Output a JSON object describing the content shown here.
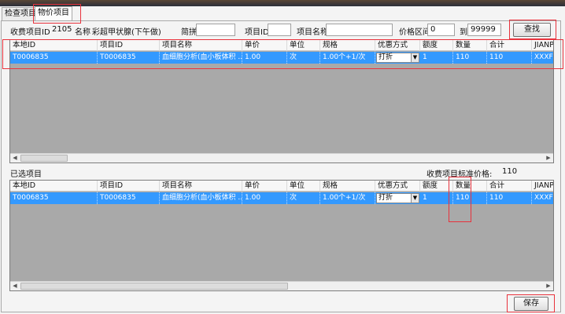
{
  "tabs": [
    "检查项目",
    "物价项目"
  ],
  "filters": {
    "charge_item_id_label": "收费项目ID",
    "charge_item_id_value": "2105",
    "name_label": "名称",
    "name_value": "彩超甲状腺(下午做)",
    "pinyin_label": "简拼",
    "pinyin_value": "",
    "item_id_label": "项目ID",
    "item_id_value": "",
    "item_name_label": "项目名称",
    "item_name_value": "",
    "price_range_label": "价格区间",
    "price_min": "0",
    "price_to_label": "到",
    "price_max": "99999",
    "search_button": "查找"
  },
  "columns": [
    "本地ID",
    "项目ID",
    "项目名称",
    "单价",
    "单位",
    "规格",
    "优惠方式",
    "额度",
    "数量",
    "合计",
    "JIANPI"
  ],
  "top_grid": {
    "rows": [
      [
        "T0006835",
        "T0006835",
        "血细胞分析(血小板体积 ...",
        "1.00",
        "次",
        "1.00个+1/次",
        "打折",
        "1",
        "110",
        "110",
        "XXXFX"
      ]
    ]
  },
  "selected_section": {
    "label": "已选项目",
    "std_price_label": "收费项目标准价格:",
    "std_price_value": "110"
  },
  "bottom_grid": {
    "rows": [
      [
        "T0006835",
        "T0006835",
        "血细胞分析(血小板体积 ...",
        "1.00",
        "次",
        "1.00个+1/次",
        "打折",
        "1",
        "110",
        "110",
        "XXXFX"
      ]
    ]
  },
  "save_button": "保存",
  "colors": {
    "selection": "#3399ff",
    "grid_bg": "#a9a9a9",
    "highlight": "#e8323c"
  }
}
